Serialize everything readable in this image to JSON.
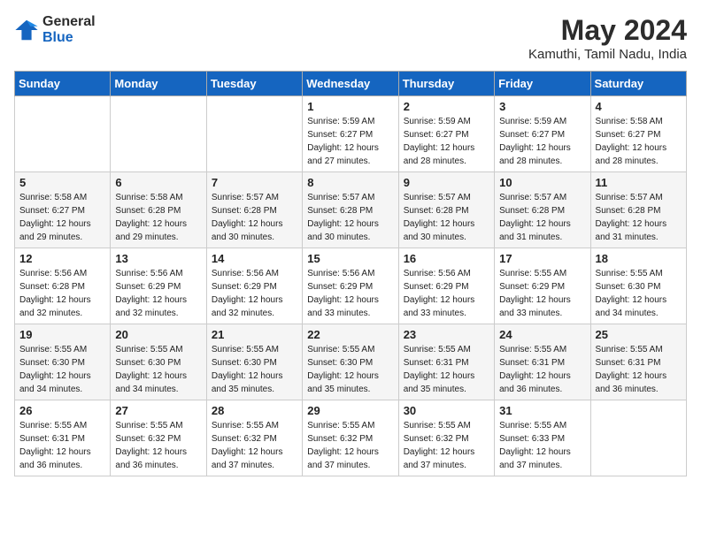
{
  "header": {
    "logo_line1": "General",
    "logo_line2": "Blue",
    "month_year": "May 2024",
    "location": "Kamuthi, Tamil Nadu, India"
  },
  "weekdays": [
    "Sunday",
    "Monday",
    "Tuesday",
    "Wednesday",
    "Thursday",
    "Friday",
    "Saturday"
  ],
  "weeks": [
    [
      {
        "day": "",
        "info": ""
      },
      {
        "day": "",
        "info": ""
      },
      {
        "day": "",
        "info": ""
      },
      {
        "day": "1",
        "info": "Sunrise: 5:59 AM\nSunset: 6:27 PM\nDaylight: 12 hours\nand 27 minutes."
      },
      {
        "day": "2",
        "info": "Sunrise: 5:59 AM\nSunset: 6:27 PM\nDaylight: 12 hours\nand 28 minutes."
      },
      {
        "day": "3",
        "info": "Sunrise: 5:59 AM\nSunset: 6:27 PM\nDaylight: 12 hours\nand 28 minutes."
      },
      {
        "day": "4",
        "info": "Sunrise: 5:58 AM\nSunset: 6:27 PM\nDaylight: 12 hours\nand 28 minutes."
      }
    ],
    [
      {
        "day": "5",
        "info": "Sunrise: 5:58 AM\nSunset: 6:27 PM\nDaylight: 12 hours\nand 29 minutes."
      },
      {
        "day": "6",
        "info": "Sunrise: 5:58 AM\nSunset: 6:28 PM\nDaylight: 12 hours\nand 29 minutes."
      },
      {
        "day": "7",
        "info": "Sunrise: 5:57 AM\nSunset: 6:28 PM\nDaylight: 12 hours\nand 30 minutes."
      },
      {
        "day": "8",
        "info": "Sunrise: 5:57 AM\nSunset: 6:28 PM\nDaylight: 12 hours\nand 30 minutes."
      },
      {
        "day": "9",
        "info": "Sunrise: 5:57 AM\nSunset: 6:28 PM\nDaylight: 12 hours\nand 30 minutes."
      },
      {
        "day": "10",
        "info": "Sunrise: 5:57 AM\nSunset: 6:28 PM\nDaylight: 12 hours\nand 31 minutes."
      },
      {
        "day": "11",
        "info": "Sunrise: 5:57 AM\nSunset: 6:28 PM\nDaylight: 12 hours\nand 31 minutes."
      }
    ],
    [
      {
        "day": "12",
        "info": "Sunrise: 5:56 AM\nSunset: 6:28 PM\nDaylight: 12 hours\nand 32 minutes."
      },
      {
        "day": "13",
        "info": "Sunrise: 5:56 AM\nSunset: 6:29 PM\nDaylight: 12 hours\nand 32 minutes."
      },
      {
        "day": "14",
        "info": "Sunrise: 5:56 AM\nSunset: 6:29 PM\nDaylight: 12 hours\nand 32 minutes."
      },
      {
        "day": "15",
        "info": "Sunrise: 5:56 AM\nSunset: 6:29 PM\nDaylight: 12 hours\nand 33 minutes."
      },
      {
        "day": "16",
        "info": "Sunrise: 5:56 AM\nSunset: 6:29 PM\nDaylight: 12 hours\nand 33 minutes."
      },
      {
        "day": "17",
        "info": "Sunrise: 5:55 AM\nSunset: 6:29 PM\nDaylight: 12 hours\nand 33 minutes."
      },
      {
        "day": "18",
        "info": "Sunrise: 5:55 AM\nSunset: 6:30 PM\nDaylight: 12 hours\nand 34 minutes."
      }
    ],
    [
      {
        "day": "19",
        "info": "Sunrise: 5:55 AM\nSunset: 6:30 PM\nDaylight: 12 hours\nand 34 minutes."
      },
      {
        "day": "20",
        "info": "Sunrise: 5:55 AM\nSunset: 6:30 PM\nDaylight: 12 hours\nand 34 minutes."
      },
      {
        "day": "21",
        "info": "Sunrise: 5:55 AM\nSunset: 6:30 PM\nDaylight: 12 hours\nand 35 minutes."
      },
      {
        "day": "22",
        "info": "Sunrise: 5:55 AM\nSunset: 6:30 PM\nDaylight: 12 hours\nand 35 minutes."
      },
      {
        "day": "23",
        "info": "Sunrise: 5:55 AM\nSunset: 6:31 PM\nDaylight: 12 hours\nand 35 minutes."
      },
      {
        "day": "24",
        "info": "Sunrise: 5:55 AM\nSunset: 6:31 PM\nDaylight: 12 hours\nand 36 minutes."
      },
      {
        "day": "25",
        "info": "Sunrise: 5:55 AM\nSunset: 6:31 PM\nDaylight: 12 hours\nand 36 minutes."
      }
    ],
    [
      {
        "day": "26",
        "info": "Sunrise: 5:55 AM\nSunset: 6:31 PM\nDaylight: 12 hours\nand 36 minutes."
      },
      {
        "day": "27",
        "info": "Sunrise: 5:55 AM\nSunset: 6:32 PM\nDaylight: 12 hours\nand 36 minutes."
      },
      {
        "day": "28",
        "info": "Sunrise: 5:55 AM\nSunset: 6:32 PM\nDaylight: 12 hours\nand 37 minutes."
      },
      {
        "day": "29",
        "info": "Sunrise: 5:55 AM\nSunset: 6:32 PM\nDaylight: 12 hours\nand 37 minutes."
      },
      {
        "day": "30",
        "info": "Sunrise: 5:55 AM\nSunset: 6:32 PM\nDaylight: 12 hours\nand 37 minutes."
      },
      {
        "day": "31",
        "info": "Sunrise: 5:55 AM\nSunset: 6:33 PM\nDaylight: 12 hours\nand 37 minutes."
      },
      {
        "day": "",
        "info": ""
      }
    ]
  ]
}
